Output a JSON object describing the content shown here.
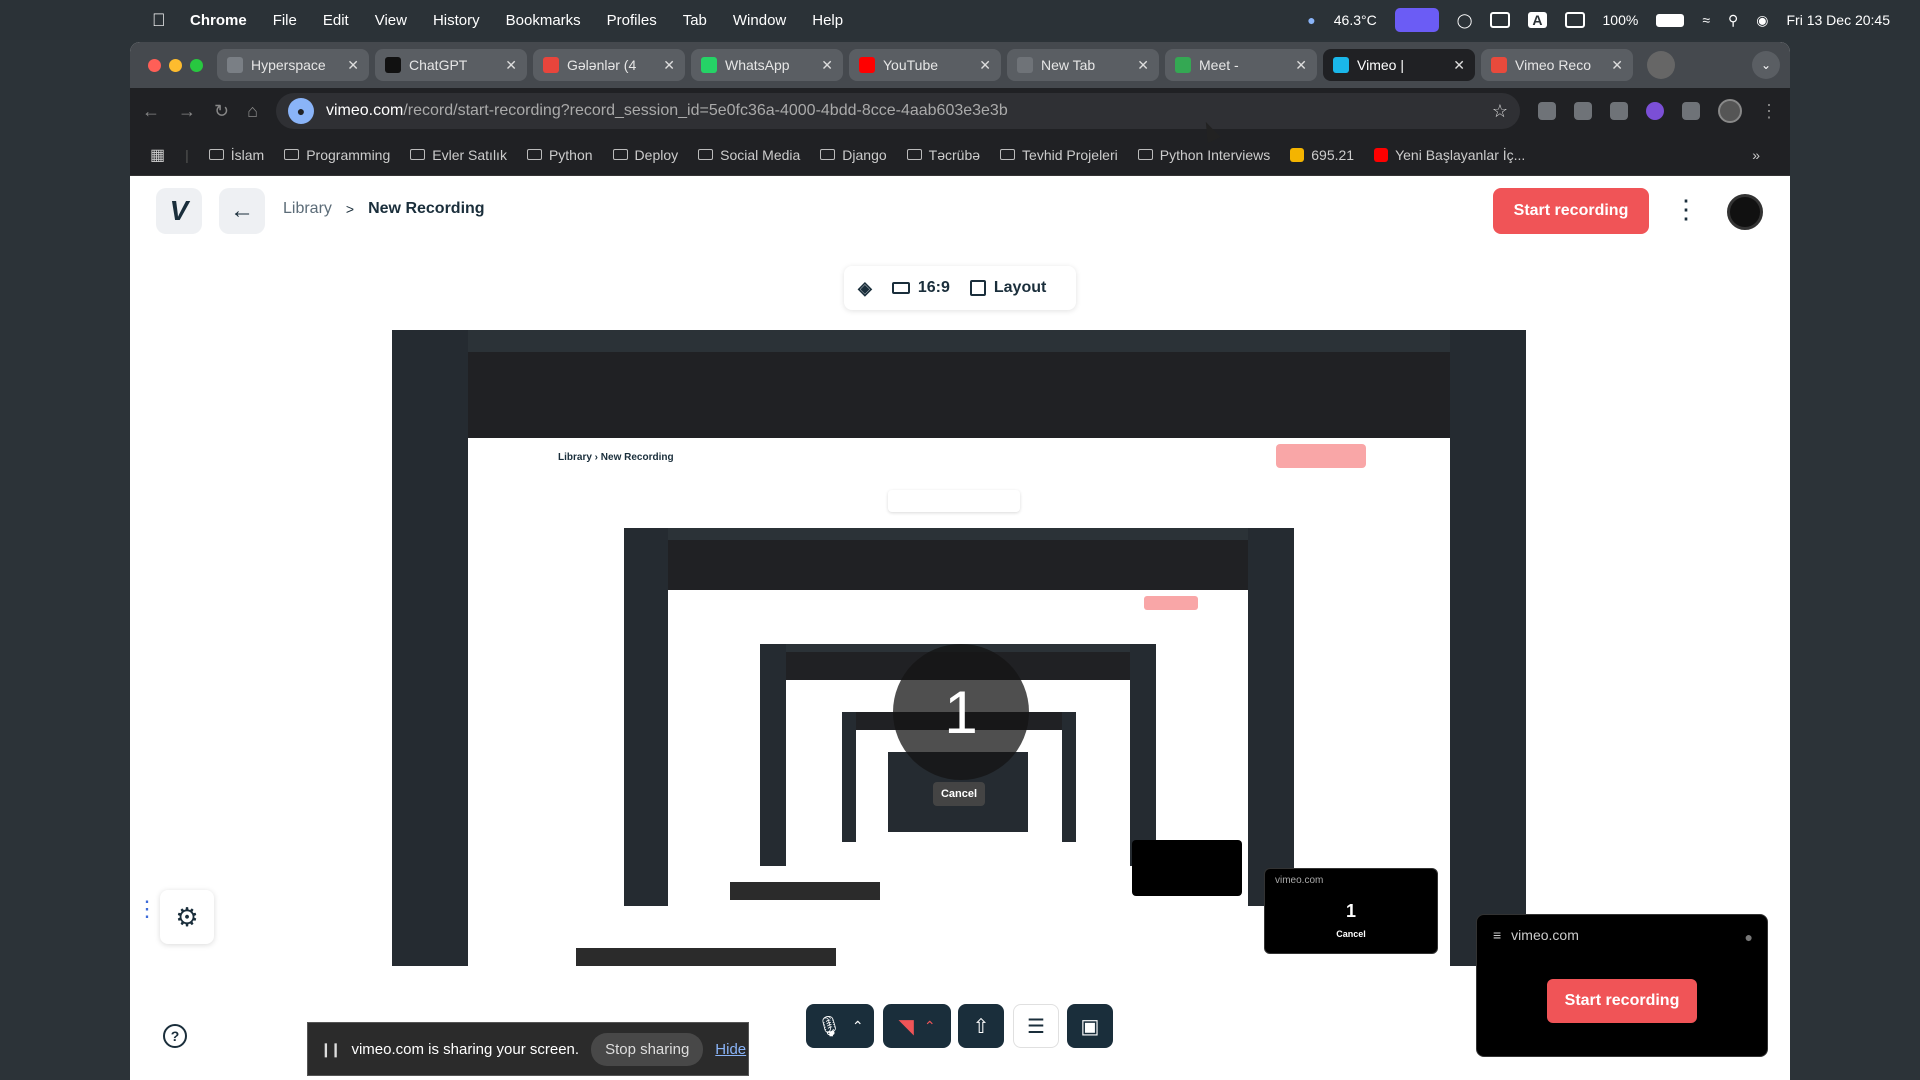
{
  "menubar": {
    "app": "Chrome",
    "items": [
      "File",
      "Edit",
      "View",
      "History",
      "Bookmarks",
      "Profiles",
      "Tab",
      "Window",
      "Help"
    ],
    "temperature": "46.3°C",
    "battery": "100%",
    "datetime": "Fri 13 Dec  20:45"
  },
  "tabs": [
    {
      "label": "Hyperspace",
      "color": "#7a7f85"
    },
    {
      "label": "ChatGPT",
      "color": "#111111"
    },
    {
      "label": "Gələnlər (4",
      "color": "#e8453c"
    },
    {
      "label": "WhatsApp",
      "color": "#25d366"
    },
    {
      "label": "YouTube",
      "color": "#ff0000"
    },
    {
      "label": "New Tab",
      "color": "#6f7378"
    },
    {
      "label": "Meet - ",
      "color": "#34a853"
    },
    {
      "label": "Vimeo | ",
      "color": "#1ab7ea",
      "active": true
    },
    {
      "label": "Vimeo Reco",
      "color": "#e84a3c"
    }
  ],
  "address": {
    "host": "vimeo.com",
    "path": "/record/start-recording?record_session_id=5e0fc36a-4000-4bdd-8cce-4aab603e3e3b"
  },
  "bookmarks": [
    {
      "label": "İslam",
      "type": "folder"
    },
    {
      "label": "Programming",
      "type": "folder"
    },
    {
      "label": "Evler Satılık",
      "type": "folder"
    },
    {
      "label": "Python",
      "type": "folder"
    },
    {
      "label": "Deploy",
      "type": "folder"
    },
    {
      "label": "Social Media",
      "type": "folder"
    },
    {
      "label": "Django",
      "type": "folder"
    },
    {
      "label": "Təcrübə",
      "type": "folder"
    },
    {
      "label": "Tevhid Projeleri",
      "type": "folder"
    },
    {
      "label": "Python Interviews",
      "type": "folder"
    },
    {
      "label": "695.21",
      "type": "link",
      "color": "#f4b400"
    },
    {
      "label": "Yeni Başlayanlar İç...",
      "type": "link",
      "color": "#ff0000"
    }
  ],
  "page": {
    "logo": "V",
    "breadcrumb": {
      "library": "Library",
      "sep": ">",
      "current": "New Recording"
    },
    "start_recording": "Start recording",
    "options": {
      "aspect": "16:9",
      "layout": "Layout"
    }
  },
  "preview": {
    "countdown": "1",
    "cancel": "Cancel",
    "popup_host": "vimeo.com",
    "popup_count": "1",
    "popup_cancel": "Cancel"
  },
  "share_banner": {
    "text": "vimeo.com is sharing your screen.",
    "stop": "Stop sharing",
    "hide": "Hide"
  },
  "rec_popup": {
    "host": "vimeo.com",
    "button": "Start recording"
  },
  "colors": {
    "accent": "#f05457",
    "navy": "#1a2e3b",
    "active_purple": "#6b5cf5"
  }
}
